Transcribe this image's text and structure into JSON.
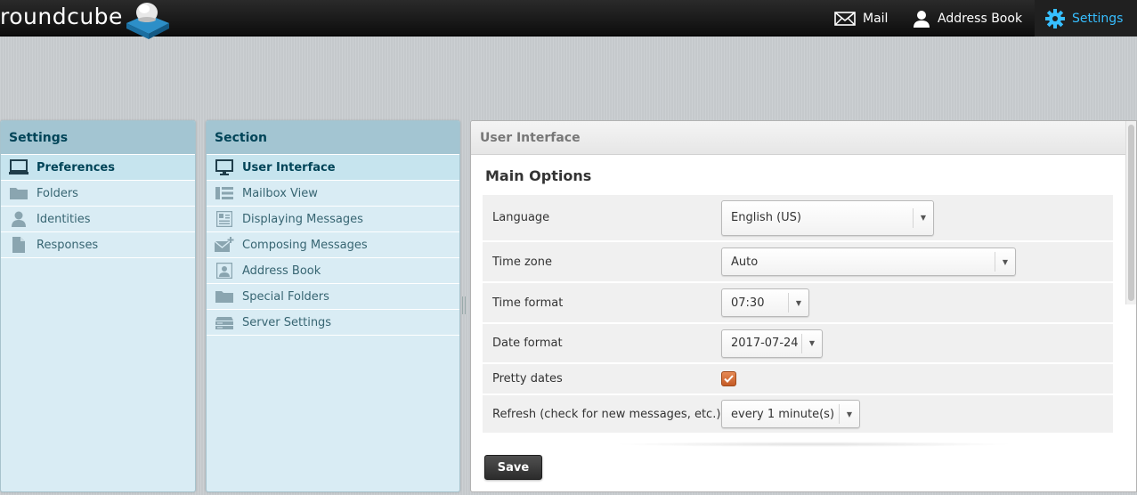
{
  "app": {
    "logo_text": "roundcube"
  },
  "topnav": {
    "mail": "Mail",
    "address_book": "Address Book",
    "settings": "Settings"
  },
  "colors": {
    "accent": "#37beff",
    "panel_bg": "#d9ecf4",
    "checkbox": "#d0693a"
  },
  "settings_panel": {
    "title": "Settings",
    "items": [
      {
        "label": "Preferences",
        "icon": "monitor-icon",
        "selected": true
      },
      {
        "label": "Folders",
        "icon": "folder-icon",
        "selected": false
      },
      {
        "label": "Identities",
        "icon": "person-icon",
        "selected": false
      },
      {
        "label": "Responses",
        "icon": "document-icon",
        "selected": false
      }
    ]
  },
  "section_panel": {
    "title": "Section",
    "items": [
      {
        "label": "User Interface",
        "icon": "monitor-icon",
        "selected": true
      },
      {
        "label": "Mailbox View",
        "icon": "list-view-icon",
        "selected": false
      },
      {
        "label": "Displaying Messages",
        "icon": "message-view-icon",
        "selected": false
      },
      {
        "label": "Composing Messages",
        "icon": "compose-envelope-icon",
        "selected": false
      },
      {
        "label": "Address Book",
        "icon": "contact-card-icon",
        "selected": false
      },
      {
        "label": "Special Folders",
        "icon": "folder-icon",
        "selected": false
      },
      {
        "label": "Server Settings",
        "icon": "server-icon",
        "selected": false
      }
    ]
  },
  "main": {
    "header": "User Interface",
    "section_title": "Main Options",
    "options": {
      "language": {
        "label": "Language",
        "value": "English (US)"
      },
      "timezone": {
        "label": "Time zone",
        "value": "Auto"
      },
      "time_format": {
        "label": "Time format",
        "value": "07:30"
      },
      "date_format": {
        "label": "Date format",
        "value": "2017-07-24"
      },
      "pretty_dates": {
        "label": "Pretty dates",
        "checked": true
      },
      "refresh": {
        "label": "Refresh (check for new messages, etc.)",
        "value": "every 1 minute(s)"
      }
    },
    "save_label": "Save"
  }
}
